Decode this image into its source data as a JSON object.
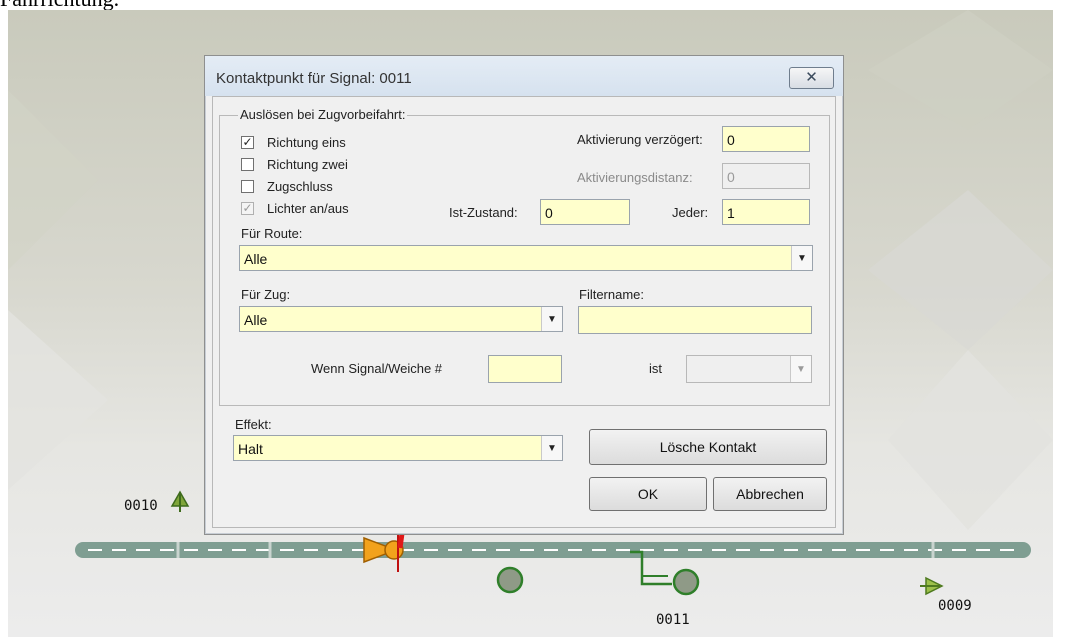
{
  "page_header": "Fahrrichtung.",
  "dialog": {
    "title": "Kontaktpunkt für Signal: 0011",
    "close_glyph": "✕",
    "trigger_group_label": "Auslösen bei Zugvorbeifahrt:",
    "checkboxes": [
      {
        "label": "Richtung eins",
        "checked": true,
        "disabled": false
      },
      {
        "label": "Richtung zwei",
        "checked": false,
        "disabled": false
      },
      {
        "label": "Zugschluss",
        "checked": false,
        "disabled": false
      },
      {
        "label": "Lichter an/aus",
        "checked": true,
        "disabled": true
      }
    ],
    "activation_delay_label": "Aktivierung verzögert:",
    "activation_delay_value": "0",
    "activation_distance_label": "Aktivierungsdistanz:",
    "activation_distance_value": "0",
    "actual_state_label": "Ist-Zustand:",
    "actual_state_value": "0",
    "each_label": "Jeder:",
    "each_value": "1",
    "route_label": "Für Route:",
    "route_value": "Alle",
    "train_label": "Für Zug:",
    "train_value": "Alle",
    "filter_name_label": "Filtername:",
    "filter_name_value": "",
    "if_signal_label": "Wenn Signal/Weiche #",
    "if_signal_value": "",
    "is_label": "ist",
    "is_value": "",
    "effect_label": "Effekt:",
    "effect_value": "Halt",
    "delete_button": "Lösche Kontakt",
    "ok_button": "OK",
    "cancel_button": "Abbrechen",
    "dropdown_glyph": "▼"
  },
  "track": {
    "signal_labels": [
      "0010",
      "0011",
      "0009"
    ]
  },
  "colors": {
    "input_bg": "#ffffcc",
    "track": "#7f9e92",
    "signal_green": "#3c8a32",
    "marker_orange": "#f2a21c",
    "arrow_red": "#e01818"
  }
}
